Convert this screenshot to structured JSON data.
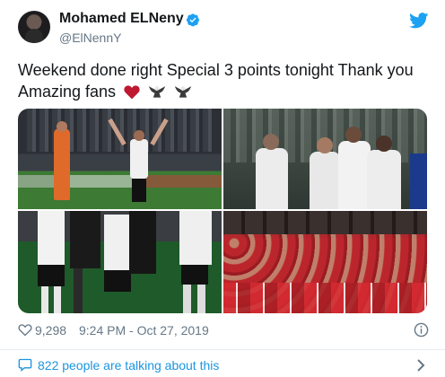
{
  "author": {
    "name": "Mohamed ELNeny",
    "handle": "@ElNennY",
    "verified": true
  },
  "tweet": {
    "text": "Weekend done right Special 3 points tonight Thank you Amazing fans",
    "emojis": [
      "red-heart",
      "eagle",
      "eagle"
    ]
  },
  "media": {
    "photos": [
      "photo-celebration-pitch",
      "photo-players-huddle",
      "photo-players-walking",
      "photo-team-dressing-room"
    ]
  },
  "stats": {
    "likes": "9,298",
    "timestamp": "9:24 PM - Oct 27, 2019"
  },
  "conversation": {
    "label": "822 people are talking about this"
  },
  "colors": {
    "text": "#14171a",
    "secondary": "#657786",
    "link": "#1b95e0",
    "twitter_blue": "#1da1f2",
    "heart": "#e0245e"
  }
}
